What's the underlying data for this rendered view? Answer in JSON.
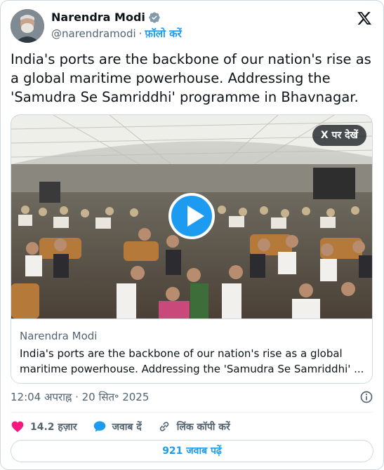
{
  "author": {
    "name": "Narendra Modi",
    "handle": "@narendramodi",
    "separator": "·",
    "follow_label": "फ़ॉलो करें"
  },
  "icons": {
    "verified": "verified-badge-icon",
    "x_logo": "x-logo-icon",
    "play": "play-icon",
    "info": "info-icon",
    "like": "heart-icon",
    "reply": "speech-bubble-icon",
    "link": "link-icon"
  },
  "colors": {
    "accent": "#1d9bf0",
    "like": "#f91880",
    "text": "#0f1419",
    "muted": "#536471"
  },
  "tweet": {
    "text": "India's ports are the backbone of our nation's rise as a global maritime powerhouse. Addressing the 'Samudra Se Samriddhi' programme in Bhavnagar."
  },
  "media": {
    "watch_on_x": "X पर देखें",
    "link_site": "Narendra Modi",
    "link_description": "India's ports are the backbone of our nation's rise as a global maritime powerhouse. Addressing the 'Samudra Se Samriddhi' ..."
  },
  "meta": {
    "timestamp": "12:04 अपराह्न · 20 सित॰ 2025"
  },
  "actions": {
    "likes": "14.2 हज़ार",
    "reply": "जवाब दें",
    "copy_link": "लिंक कॉपी करें"
  },
  "replies_button": "921 जवाब पढ़ें"
}
